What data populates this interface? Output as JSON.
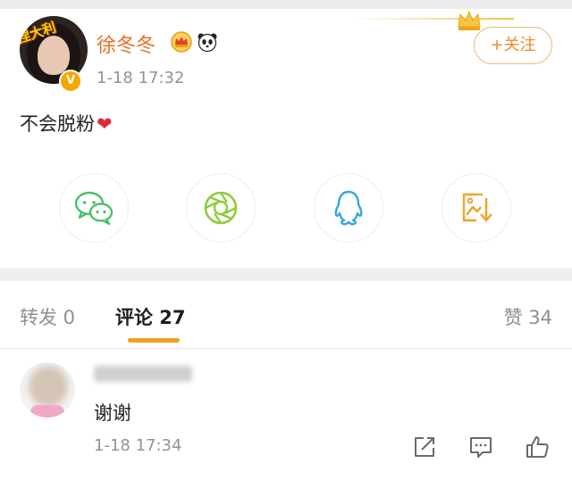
{
  "post": {
    "author": "徐冬冬",
    "avatar_sticker": "捏大利",
    "verified_mark": "V",
    "time": "1-18 17:32",
    "text": "不会脱粉",
    "emoji": "❤",
    "follow_label": "+关注",
    "badges": [
      "crown-icon",
      "panda-icon"
    ]
  },
  "share": {
    "targets": [
      "wechat-icon",
      "moments-icon",
      "qq-icon",
      "save-image-icon"
    ]
  },
  "tabs": {
    "repost": "转发 0",
    "comment": "评论 27",
    "like": "赞 34"
  },
  "comment": {
    "text": "谢谢",
    "time": "1-18 17:34",
    "actions": [
      "share-icon",
      "reply-icon",
      "like-icon"
    ]
  },
  "colors": {
    "accent_orange": "#ee8a2d",
    "username": "#e8712a",
    "tab_underline": "#f0a020",
    "gray_text": "#939393"
  }
}
